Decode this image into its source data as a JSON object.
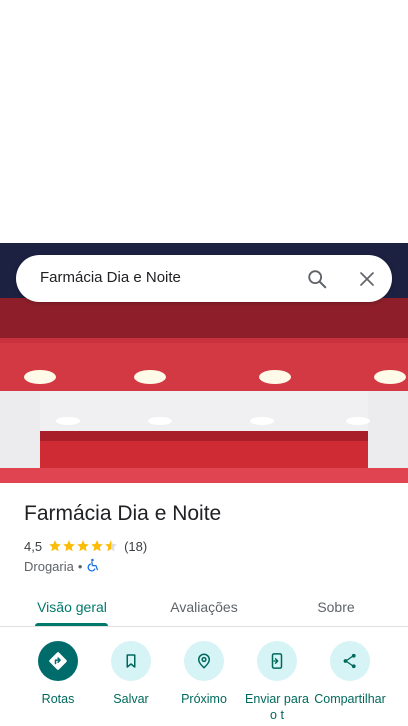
{
  "search": {
    "query": "Farmácia Dia e Noite",
    "search_icon": "search-icon",
    "close_icon": "close-icon"
  },
  "place": {
    "name": "Farmácia Dia e Noite",
    "rating": "4,5",
    "rating_stars": 4.5,
    "reviews_count": "(18)",
    "category": "Drogaria",
    "separator": "•",
    "accessibility_icon": "wheelchair-icon"
  },
  "tabs": [
    {
      "label": "Visão geral",
      "active": true
    },
    {
      "label": "Avaliações",
      "active": false
    },
    {
      "label": "Sobre",
      "active": false
    }
  ],
  "actions": [
    {
      "label": "Rotas",
      "icon": "directions-icon"
    },
    {
      "label": "Salvar",
      "icon": "bookmark-icon"
    },
    {
      "label": "Próximo",
      "icon": "nearby-icon"
    },
    {
      "label": "Enviar para o t",
      "icon": "send-to-phone-icon"
    },
    {
      "label": "Compartilhar",
      "icon": "share-icon"
    }
  ],
  "colors": {
    "accent": "#00796b",
    "action_bg": "#d6f3f6",
    "primary_action_bg": "#006b6b",
    "star": "#fbbc04"
  }
}
